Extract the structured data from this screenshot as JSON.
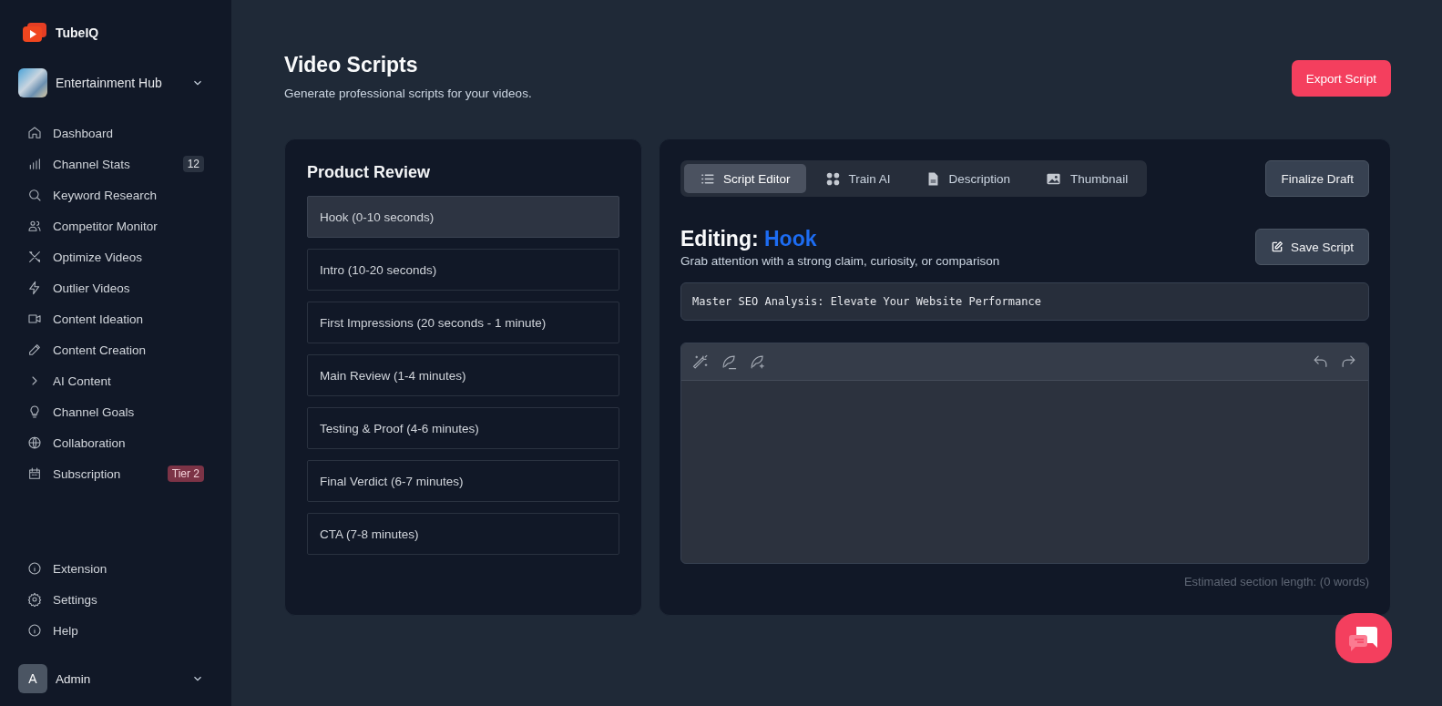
{
  "brand": {
    "name": "TubeIQ"
  },
  "channel": {
    "name": "Entertainment Hub"
  },
  "nav": [
    {
      "label": "Dashboard"
    },
    {
      "label": "Channel Stats",
      "badge": {
        "text": "12",
        "kind": "count"
      }
    },
    {
      "label": "Keyword Research"
    },
    {
      "label": "Competitor Monitor"
    },
    {
      "label": "Optimize Videos"
    },
    {
      "label": "Outlier Videos"
    },
    {
      "label": "Content Ideation"
    },
    {
      "label": "Content Creation"
    },
    {
      "label": "AI Content",
      "expanded": false
    },
    {
      "label": "Channel Goals"
    },
    {
      "label": "Collaboration"
    },
    {
      "label": "Subscription",
      "badge": {
        "text": "Tier 2",
        "kind": "tier"
      }
    }
  ],
  "bottom_nav": [
    {
      "label": "Extension"
    },
    {
      "label": "Settings"
    },
    {
      "label": "Help"
    }
  ],
  "user": {
    "initial": "A",
    "name": "Admin"
  },
  "header": {
    "title": "Video Scripts",
    "subtitle": "Generate professional scripts for your videos.",
    "export_button": "Export Script"
  },
  "template": {
    "title": "Product Review",
    "sections": [
      {
        "label": "Hook (0-10 seconds)",
        "selected": true
      },
      {
        "label": "Intro (10-20 seconds)",
        "selected": false
      },
      {
        "label": "First Impressions (20 seconds - 1 minute)",
        "selected": false
      },
      {
        "label": "Main Review (1-4 minutes)",
        "selected": false
      },
      {
        "label": "Testing & Proof (4-6 minutes)",
        "selected": false
      },
      {
        "label": "Final Verdict (6-7 minutes)",
        "selected": false
      },
      {
        "label": "CTA (7-8 minutes)",
        "selected": false
      }
    ]
  },
  "tabs": [
    {
      "label": "Script Editor",
      "selected": true
    },
    {
      "label": "Train AI",
      "selected": false
    },
    {
      "label": "Description",
      "selected": false
    },
    {
      "label": "Thumbnail",
      "selected": false
    }
  ],
  "finalize_button": "Finalize Draft",
  "editor": {
    "editing_label": "Editing:",
    "section_name": "Hook",
    "hint": "Grab attention with a strong claim, curiosity, or comparison",
    "save_button": "Save Script",
    "title_value": "Master SEO Analysis: Elevate Your Website Performance",
    "word_count": "Estimated section length: (0 words)"
  }
}
